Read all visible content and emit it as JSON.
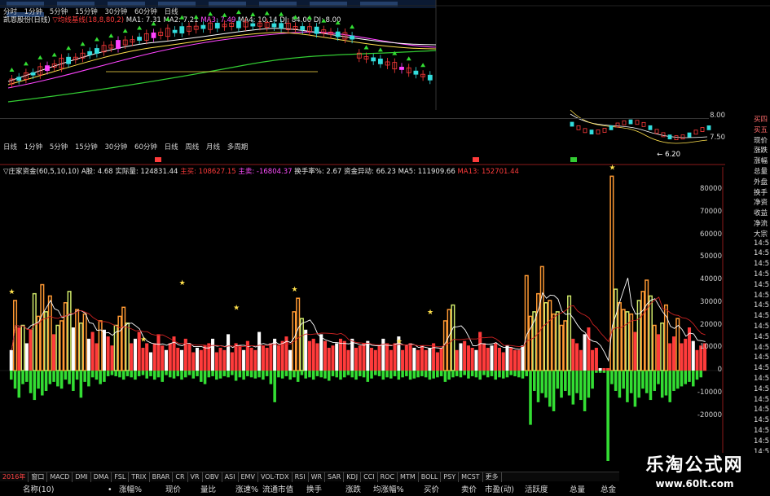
{
  "top_periods": [
    "分时",
    "1分钟",
    "5分钟",
    "15分钟",
    "30分钟",
    "60分钟",
    "日线"
  ],
  "info_top": {
    "stock": "凯恩股份(日线)",
    "indicator": "▽均线基线(18,8,80,2)",
    "ma1": "MA1: 7.31",
    "ma2": "MA2: 7.21",
    "ma3": "MA3: 7.49",
    "ma4": "MA4: 10.14",
    "dj": "DJ: 84.00",
    "dj2": "DJ: 8.00"
  },
  "mid_periods": [
    "日线",
    "1分钟",
    "5分钟",
    "15分钟",
    "30分钟",
    "60分钟",
    "日线",
    "周线",
    "月线",
    "多周期"
  ],
  "info_bottom": {
    "indicator": "▽庄家资金(60,5,10,10)",
    "a": "A股: 4.68",
    "real_vol": "实际量: 124831.44",
    "main_buy": "主买: 108627.15",
    "main_sell": "主卖: -16804.37",
    "turnover": "换手率%: 2.67",
    "fund_abn": "资金异动: 66.23",
    "ma5": "MA5: 111909.66",
    "ma13": "MA13: 152701.44"
  },
  "mini_chart": {
    "price_high": "8.00",
    "price_low": "7.50",
    "last_label": "← 6.20"
  },
  "y_ticks": [
    "80000",
    "70000",
    "60000",
    "50000",
    "40000",
    "30000",
    "20000",
    "10000",
    "0",
    "-10000",
    "-20000"
  ],
  "right_panel": [
    "买四",
    "买五",
    "现价",
    "涨跌",
    "涨幅",
    "总量",
    "外盘",
    "换手",
    "净资",
    "收益",
    "净流",
    "大宗",
    "14:5",
    "14:5",
    "14:5",
    "14:5",
    "14:5",
    "14:5",
    "14:5",
    "14:5",
    "14:5",
    "14:5",
    "14:5",
    "14:5",
    "14:5",
    "14:5",
    "14:5",
    "14:5",
    "14:5",
    "14:5",
    "14:5",
    "14:5",
    "14:5"
  ],
  "toolbar": [
    "2016年",
    "窗口",
    "MACD",
    "DMI",
    "DMA",
    "FSL",
    "TRIX",
    "BRAR",
    "CR",
    "VR",
    "OBV",
    "ASI",
    "EMV",
    "VOL-TDX",
    "RSI",
    "WR",
    "SAR",
    "KDJ",
    "CCI",
    "ROC",
    "MTM",
    "BOLL",
    "PSY",
    "MCST",
    "更多"
  ],
  "columns": [
    "名称(10)",
    "•",
    "涨幅%",
    "现价",
    "量比",
    "涨速%",
    "流通市值",
    "换手",
    "涨跌",
    "均涨幅%",
    "买价",
    "卖价",
    "市盈(动)",
    "活跃度",
    "总量",
    "总金"
  ],
  "watermark": {
    "cn": "乐淘公式网",
    "url": "www.60lt.com"
  },
  "colors": {
    "up": "#ff3b3b",
    "down": "#33dd33",
    "orange": "#ff9933",
    "axis": "#8b1a1a"
  },
  "chart_data": {
    "type": "bar",
    "title": "庄家资金",
    "ylim": [
      -25000,
      95000
    ],
    "positive": [
      9000,
      31000,
      19000,
      20000,
      12000,
      18000,
      34000,
      24000,
      38000,
      26000,
      33000,
      16000,
      20000,
      22000,
      30000,
      35000,
      19000,
      27000,
      21000,
      25000,
      14000,
      17000,
      12000,
      22000,
      18000,
      15000,
      11000,
      20000,
      24000,
      28000,
      21000,
      12000,
      14000,
      17000,
      10000,
      12000,
      8000,
      12000,
      16000,
      11000,
      9000,
      12000,
      15000,
      10000,
      9000,
      14000,
      12000,
      8000,
      10000,
      9000,
      11000,
      12000,
      14000,
      8000,
      10000,
      9000,
      16000,
      8000,
      12000,
      11000,
      9000,
      13000,
      10000,
      9000,
      17000,
      11000,
      10000,
      12000,
      14000,
      11000,
      13000,
      15000,
      9000,
      26000,
      32000,
      23000,
      18000,
      13000,
      14000,
      12000,
      16000,
      13000,
      10000,
      11000,
      12000,
      14000,
      13000,
      9000,
      14000,
      10000,
      11000,
      12000,
      13000,
      10000,
      9000,
      11000,
      14000,
      12000,
      9000,
      12000,
      15000,
      9000,
      11000,
      12000,
      10000,
      9000,
      11000,
      9000,
      10000,
      12000,
      8000,
      10000,
      22000,
      27000,
      29000,
      9000,
      12000,
      13000,
      11000,
      10000,
      9000,
      17000,
      12000,
      10000,
      11000,
      12000,
      10000,
      8000,
      11000,
      10000,
      9000,
      9000,
      11000,
      42000,
      24000,
      26000,
      34000,
      46000,
      30000,
      31000,
      25000,
      26000,
      20000,
      22000,
      33000,
      14000,
      12000,
      9000,
      16000,
      19000,
      9000,
      10000,
      1000,
      1000,
      1000,
      86000,
      36000,
      30000,
      27000,
      26000,
      25000,
      17000,
      31000,
      35000,
      40000,
      33000,
      20000,
      16000,
      21000,
      29000,
      12000,
      15000,
      23000,
      12000,
      14000,
      19000,
      13000,
      9000,
      11000,
      12000
    ],
    "negative": [
      -4000,
      -8000,
      -12000,
      -6000,
      -5000,
      -10000,
      -13000,
      -8000,
      -11000,
      -9000,
      -6000,
      -5000,
      -7000,
      -8000,
      -4000,
      -6000,
      -9000,
      -4000,
      -12000,
      -5000,
      -7000,
      -3000,
      -4000,
      -6000,
      -5000,
      -2500,
      -2000,
      -2500,
      -3000,
      -4000,
      -2500,
      -3000,
      -4000,
      -2500,
      -2000,
      -3500,
      -2500,
      -4000,
      -3000,
      -5000,
      -2000,
      -3000,
      -3500,
      -2500,
      -4000,
      -3000,
      -2000,
      -3500,
      -2500,
      -5000,
      -6000,
      -3000,
      -2500,
      -4000,
      -3500,
      -2500,
      -3000,
      -2000,
      -4500,
      -3000,
      -4000,
      -2500,
      -3000,
      -3500,
      -3000,
      -4000,
      -2500,
      -6000,
      -14000,
      -3000,
      -3500,
      -2500,
      -4000,
      -3000,
      -5000,
      -2000,
      -3500,
      -3000,
      -4000,
      -2500,
      -3000,
      -3500,
      -4500,
      -2500,
      -3000,
      -4000,
      -3000,
      -2000,
      -3000,
      -4000,
      -2500,
      -3000,
      -5000,
      -3500,
      -2000,
      -2500,
      -4000,
      -3000,
      -3500,
      -2500,
      -4000,
      -3000,
      -2500,
      -4000,
      -3500,
      -3000,
      -2500,
      -3000,
      -4000,
      -3500,
      -3000,
      -2500,
      -5000,
      -4000,
      -3000,
      -2500,
      -3000,
      -2000,
      -3500,
      -2500,
      -3000,
      -4000,
      -2000,
      -3000,
      -2500,
      -4000,
      -3000,
      -3500,
      -3000,
      -2000,
      -2500,
      -3000,
      -3500,
      -2500,
      -24000,
      -9000,
      -14000,
      -10000,
      -12000,
      -16000,
      -18000,
      -8000,
      -12000,
      -9000,
      -11000,
      -15000,
      -10000,
      -13000,
      -18000,
      -12000,
      -8000,
      -1000,
      -1000,
      -1000,
      -40000,
      -6000,
      -9000,
      -12000,
      -8000,
      -14000,
      -10000,
      -16000,
      -12000,
      -8000,
      -10000,
      -13000,
      -9000,
      -6000,
      -12000,
      -11000,
      -14000,
      -9000,
      -8000,
      -7000,
      -6000,
      -5000,
      -7000,
      -4000,
      -3000
    ]
  }
}
